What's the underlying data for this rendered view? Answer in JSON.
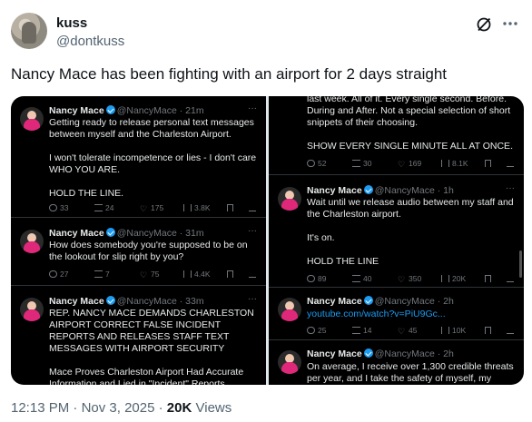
{
  "author": {
    "name": "kuss",
    "handle": "@dontkuss"
  },
  "icons": {
    "grok": "grok-icon",
    "more": "more-icon"
  },
  "tweet_text": "Nancy Mace has been fighting with an airport for 2 days straight",
  "left_posts": [
    {
      "name": "Nancy Mace",
      "handle": "@NancyMace",
      "time": "21m",
      "body": "Getting ready to release personal text messages between myself and the Charleston Airport.\n\nI won't tolerate incompetence or lies - I don't care WHO YOU ARE.\n\nHOLD THE LINE.",
      "replies": "33",
      "reposts": "24",
      "likes": "175",
      "views": "3.8K"
    },
    {
      "name": "Nancy Mace",
      "handle": "@NancyMace",
      "time": "31m",
      "body": "How does somebody you're supposed to be on the lookout for slip right by you?",
      "replies": "27",
      "reposts": "7",
      "likes": "75",
      "views": "4.4K"
    },
    {
      "name": "Nancy Mace",
      "handle": "@NancyMace",
      "time": "33m",
      "body": "REP. NANCY MACE DEMANDS CHARLESTON AIRPORT CORRECT FALSE INCIDENT REPORTS AND RELEASES STAFF TEXT MESSAGES WITH AIRPORT SECURITY\n\nMace Proves Charleston Airport Had Accurate Information and Lied in \"Incident\" Reports"
    }
  ],
  "right_posts": [
    {
      "body": "last week. All of it. Every single second. Before. During and After. Not a special selection of short snippets of their choosing.\n\nSHOW EVERY SINGLE MINUTE ALL AT ONCE.",
      "replies": "52",
      "reposts": "30",
      "likes": "169",
      "views": "8.1K"
    },
    {
      "name": "Nancy Mace",
      "handle": "@NancyMace",
      "time": "1h",
      "body": "Wait until we release audio between my staff and the Charleston airport.\n\nIt's on.\n\nHOLD THE LINE",
      "replies": "89",
      "reposts": "40",
      "likes": "350",
      "views": "20K"
    },
    {
      "name": "Nancy Mace",
      "handle": "@NancyMace",
      "time": "2h",
      "link": "youtube.com/watch?v=PiU9Gc...",
      "replies": "25",
      "reposts": "14",
      "likes": "45",
      "views": "10K"
    },
    {
      "name": "Nancy Mace",
      "handle": "@NancyMace",
      "time": "2h",
      "body": "On average, I receive over 1,300 credible threats per year, and I take the safety of myself, my"
    }
  ],
  "footer": {
    "time": "12:13 PM",
    "date": "Nov 3, 2025",
    "views_count": "20K",
    "views_label": "Views"
  }
}
